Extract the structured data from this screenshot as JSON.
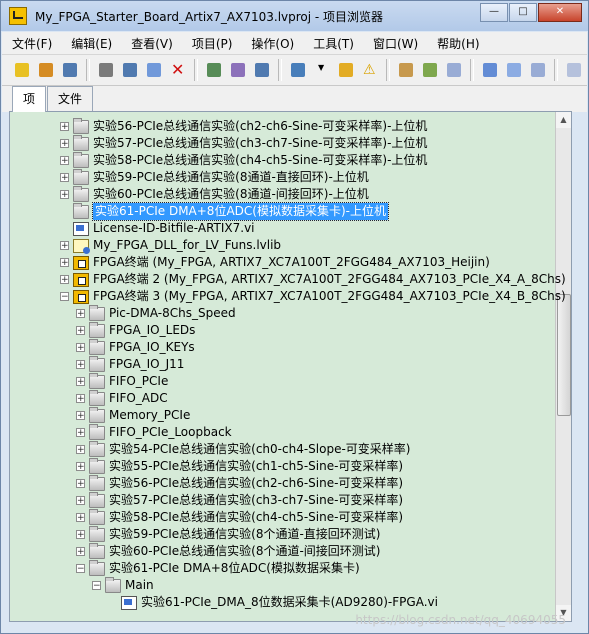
{
  "window": {
    "title": "My_FPGA_Starter_Board_Artix7_AX7103.lvproj - 项目浏览器",
    "controls": [
      "minimize-icon",
      "maximize-icon",
      "close-icon"
    ]
  },
  "menu": [
    "文件(F)",
    "编辑(E)",
    "查看(V)",
    "项目(P)",
    "操作(O)",
    "工具(T)",
    "窗口(W)",
    "帮助(H)"
  ],
  "toolbar": {
    "groups": [
      [
        "new-icon",
        "open-icon",
        "save-all-icon"
      ],
      [
        "cut-icon",
        "copy-icon",
        "paste-icon",
        "delete-icon"
      ],
      [
        "build-icon",
        "properties-icon",
        "project-icon"
      ],
      [
        "view-icon",
        "dropdown-icon",
        "resolve-icon",
        "warning-icon"
      ],
      [
        "filter-icon",
        "add-file-icon",
        "replace-icon"
      ],
      [
        "undo-icon",
        "redo-icon",
        "collapse-icon"
      ],
      [
        "expand-icon"
      ]
    ]
  },
  "tabs": [
    "项",
    "文件"
  ],
  "tree": [
    {
      "text": "实验56-PCIe总线通信实验(ch2-ch6-Sine-可变采样率)-上位机",
      "icon": "folder-icon",
      "level": 0,
      "state": "+"
    },
    {
      "text": "实验57-PCIe总线通信实验(ch3-ch7-Sine-可变采样率)-上位机",
      "icon": "folder-icon",
      "level": 0,
      "state": "+"
    },
    {
      "text": "实验58-PCIe总线通信实验(ch4-ch5-Sine-可变采样率)-上位机",
      "icon": "folder-icon",
      "level": 0,
      "state": "+"
    },
    {
      "text": "实验59-PCIe总线通信实验(8通道-直接回环)-上位机",
      "icon": "folder-icon",
      "level": 0,
      "state": "+"
    },
    {
      "text": "实验60-PCIe总线通信实验(8通道-间接回环)-上位机",
      "icon": "folder-icon",
      "level": 0,
      "state": "+"
    },
    {
      "text": "实验61-PCIe DMA+8位ADC(模拟数据采集卡)-上位机",
      "icon": "folder-icon",
      "level": 0,
      "state": "",
      "selected": true
    },
    {
      "text": "License-ID-Bitfile-ARTIX7.vi",
      "icon": "vi-icon",
      "level": 0,
      "state": ""
    },
    {
      "text": "My_FPGA_DLL_for_LV_Funs.lvlib",
      "icon": "library-icon",
      "level": 0,
      "state": "+"
    },
    {
      "text": "FPGA终端 (My_FPGA, ARTIX7_XC7A100T_2FGG484_AX7103_Heijin)",
      "icon": "fpga-target-icon",
      "level": 0,
      "state": "+"
    },
    {
      "text": "FPGA终端 2 (My_FPGA, ARTIX7_XC7A100T_2FGG484_AX7103_PCIe_X4_A_8Chs)",
      "icon": "fpga-target-icon",
      "level": 0,
      "state": "+"
    },
    {
      "text": "FPGA终端 3 (My_FPGA, ARTIX7_XC7A100T_2FGG484_AX7103_PCIe_X4_B_8Chs)",
      "icon": "fpga-target-icon",
      "level": 0,
      "state": "-"
    },
    {
      "text": "Pic-DMA-8Chs_Speed",
      "icon": "folder-icon",
      "level": 1,
      "state": "+"
    },
    {
      "text": "FPGA_IO_LEDs",
      "icon": "folder-icon",
      "level": 1,
      "state": "+"
    },
    {
      "text": "FPGA_IO_KEYs",
      "icon": "folder-icon",
      "level": 1,
      "state": "+"
    },
    {
      "text": "FPGA_IO_J11",
      "icon": "folder-icon",
      "level": 1,
      "state": "+"
    },
    {
      "text": "FIFO_PCIe",
      "icon": "folder-icon",
      "level": 1,
      "state": "+"
    },
    {
      "text": "FIFO_ADC",
      "icon": "folder-icon",
      "level": 1,
      "state": "+"
    },
    {
      "text": "Memory_PCIe",
      "icon": "folder-icon",
      "level": 1,
      "state": "+"
    },
    {
      "text": "FIFO_PCIe_Loopback",
      "icon": "folder-icon",
      "level": 1,
      "state": "+"
    },
    {
      "text": "实验54-PCIe总线通信实验(ch0-ch4-Slope-可变采样率)",
      "icon": "folder-icon",
      "level": 1,
      "state": "+"
    },
    {
      "text": "实验55-PCIe总线通信实验(ch1-ch5-Sine-可变采样率)",
      "icon": "folder-icon",
      "level": 1,
      "state": "+"
    },
    {
      "text": "实验56-PCIe总线通信实验(ch2-ch6-Sine-可变采样率)",
      "icon": "folder-icon",
      "level": 1,
      "state": "+"
    },
    {
      "text": "实验57-PCIe总线通信实验(ch3-ch7-Sine-可变采样率)",
      "icon": "folder-icon",
      "level": 1,
      "state": "+"
    },
    {
      "text": "实验58-PCIe总线通信实验(ch4-ch5-Sine-可变采样率)",
      "icon": "folder-icon",
      "level": 1,
      "state": "+"
    },
    {
      "text": "实验59-PCIe总线通信实验(8个通道-直接回环测试)",
      "icon": "folder-icon",
      "level": 1,
      "state": "+"
    },
    {
      "text": "实验60-PCIe总线通信实验(8个通道-间接回环测试)",
      "icon": "folder-icon",
      "level": 1,
      "state": "+"
    },
    {
      "text": "实验61-PCIe DMA+8位ADC(模拟数据采集卡)",
      "icon": "folder-icon",
      "level": 1,
      "state": "-"
    },
    {
      "text": "Main",
      "icon": "folder-icon",
      "level": 2,
      "state": "-"
    },
    {
      "text": "实验61-PCIe_DMA_8位数据采集卡(AD9280)-FPGA.vi",
      "icon": "vi-icon",
      "level": 3,
      "state": ""
    }
  ],
  "watermark": "https://blog.csdn.net/qq_40694055"
}
